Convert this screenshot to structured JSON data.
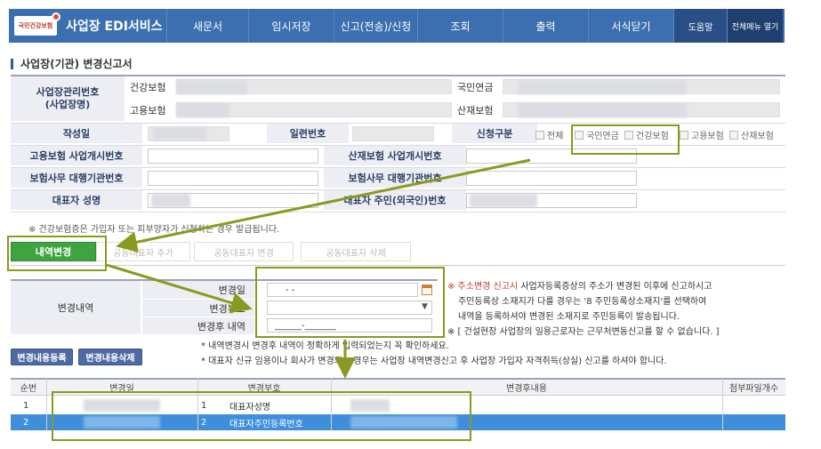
{
  "nav": {
    "logo_badge": "국민건강보험",
    "logo_text": "사업장 EDI서비스",
    "items": [
      "새문서",
      "임시저장",
      "신고(전송)/신청",
      "조회",
      "출력",
      "서식닫기"
    ],
    "help": "도움말",
    "all_menu": "전체메뉴 열기"
  },
  "page_title": "사업장(기관) 변경신고서",
  "form": {
    "mgmt_no_label": "사업장관리번호\n(사업장명)",
    "health_ins": "건강보험",
    "employ_ins": "고용보험",
    "pension": "국민연금",
    "industrial_ins": "산재보험",
    "written_date": "작성일",
    "serial_no": "일련번호",
    "apply_type": "신청구분",
    "checks": [
      "전체",
      "국민연금",
      "건강보험",
      "고용보험",
      "산재보험"
    ],
    "employ_reg_no": "고용보험 사업개시번호",
    "industrial_reg_no": "산재보험 사업개시번호",
    "agency_no": "보험사무 대행기관번호",
    "agency_no2": "보험사무 대행기관번호",
    "rep_name": "대표자 성명",
    "rep_id": "대표자 주민(외국인)번호",
    "note": "※ 건강보험증은 가입자 또는 피부양자가 신청하는 경우 발급됩니다."
  },
  "tabs": {
    "detail": "내역변경",
    "add_corep": "공동대표자 추가",
    "change_corep": "공동대표자 변경",
    "delete_corep": "공동대표자 삭제"
  },
  "change": {
    "section_label": "변경내역",
    "date_label": "변경일",
    "date_value": "-  -",
    "code_label": "변경부호",
    "after_label": "변경후 내역",
    "after_value": "______-_______"
  },
  "info_lines": {
    "line1_red": "※ 주소변경 신고시",
    "line1": " 사업자등록증상의 주소가 변경된 이후에 신고하시고",
    "line2": "주민등록상 소재지가 다를 경우는 '8 주민등록상소재지'를 선택하여",
    "line3": "내역을 등록하셔야 변경된 소재지로 주민등록이 발송됩니다.",
    "line4": "※ [ 건설현장 사업장의 일용근로자는 근무처변동신고를 할 수 없습니다. ]",
    "line5": "* 내역변경시 변경후 내역이 정확하게 입력되었는지 꼭 확인하세요.",
    "line6": "* 대표자 신규 임용이나 회사가 변경되는 경우는 사업장 내역변경신고 후 사업장 가입자 자격취득(상실) 신고를 하셔야 합니다."
  },
  "buttons": {
    "register": "변경내용등록",
    "delete": "변경내용삭제"
  },
  "table": {
    "headers": [
      "순번",
      "변경일",
      "변경부호",
      "변경후내용",
      "첨부파일개수"
    ],
    "rows": [
      {
        "no": "1",
        "code": "1",
        "code_name": "대표자성명"
      },
      {
        "no": "2",
        "code": "2",
        "code_name": "대표자주민등록번호"
      }
    ]
  },
  "colors": {
    "nav_bg": "#3b6fb0",
    "active_tab": "#3fa33f",
    "selected_row": "#3f8edc",
    "annotation": "#8a9a1f"
  }
}
